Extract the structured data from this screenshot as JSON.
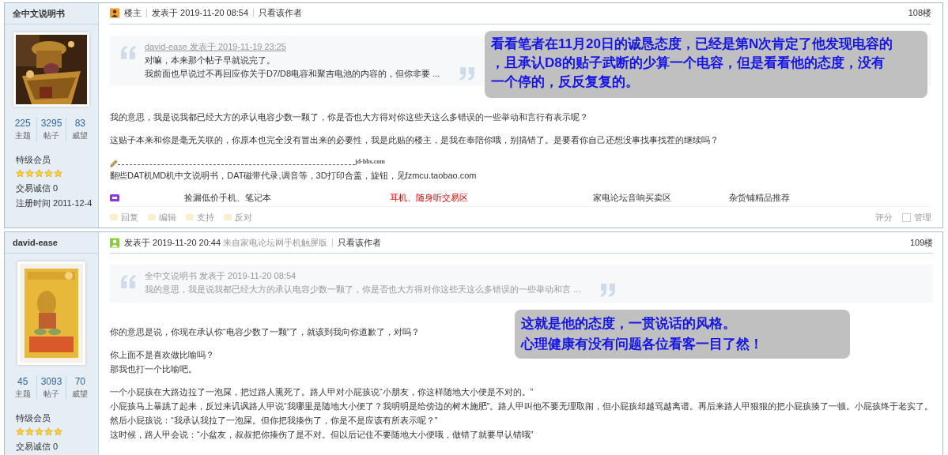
{
  "posts": [
    {
      "author": {
        "name": "全中文说明书",
        "stats": [
          {
            "value": "225",
            "label": "主题"
          },
          {
            "value": "3295",
            "label": "帖子"
          },
          {
            "value": "83",
            "label": "威望"
          }
        ],
        "rank": "特级会员",
        "stars": 5,
        "credit_label": "交易诚信",
        "credit": "0",
        "reg_label": "注册时间",
        "reg": "2011-12-4"
      },
      "header": {
        "kind": "op",
        "badge": "楼主",
        "posted": "发表于 2019-11-20 08:54",
        "author_only": "只看该作者",
        "floor": "108楼"
      },
      "quote": {
        "byline": "david-ease 发表于 2019-11-19 23:25",
        "link": true,
        "lines": [
          "对嘛，本来那个帖子早就说完了。",
          "我前面也早说过不再回应你关于D7/D8电容和聚吉电池的内容的，但你非要 ..."
        ]
      },
      "paragraphs": [
        [
          "我的意思，我是说我都已经大方的承认电容少数一颗了，你是否也大方得对你这些天这么多错误的一些举动和言行有表示呢？"
        ],
        [
          "这贴子本来和你是毫无关联的，你原本也完全没有冒出来的必要性，我是此贴的楼主，是我在奉陪你哦，别搞错了。是要看你自己还想没事找事找茬的继续吗？"
        ]
      ],
      "signature": {
        "site": "jd-bbs.com",
        "text": "翻些DAT机MD机中文说明书，DAT磁带代录,调音等，3D打印合盖，旋钮，见fzmcu.taobao.com"
      },
      "ads": [
        {
          "text": "捡漏低价手机、笔记本",
          "highlighted": false
        },
        {
          "text": "耳机、随身听交易区",
          "highlighted": true
        },
        {
          "text": "家电论坛音响买卖区",
          "highlighted": false
        },
        {
          "text": "杂货铺精品推荐",
          "highlighted": false
        }
      ],
      "actions": [
        "回复",
        "编辑",
        "支持",
        "反对"
      ],
      "manage": {
        "rate": "评分",
        "checked": false,
        "label": "管理"
      },
      "note": [
        "看看笔者在11月20日的诚恳态度，已经是第N次肯定了他发现电容的",
        "，且承认D8的贴子武断的少算一个电容，但是看看他的态度，没有",
        "一个停的，反反复复的。"
      ]
    },
    {
      "author": {
        "name": "david-ease",
        "stats": [
          {
            "value": "45",
            "label": "主题"
          },
          {
            "value": "3093",
            "label": "帖子"
          },
          {
            "value": "70",
            "label": "威望"
          }
        ],
        "rank": "特级会员",
        "stars": 5,
        "credit_label": "交易诚信",
        "credit": "0"
      },
      "header": {
        "kind": "mobile",
        "posted": "发表于 2019-11-20 20:44",
        "via": "来自家电论坛网手机触屏版",
        "author_only": "只看该作者",
        "floor": "109楼"
      },
      "quote": {
        "byline": "全中文说明书 发表于 2019-11-20 08:54",
        "link": false,
        "lines": [
          "我的意思，我是说我都已经大方的承认电容少数一颗了，你是否也大方得对你这些天这么多错误的一些举动和言 ..."
        ]
      },
      "paragraphs": [
        [
          "你的意思是说，你现在承认你“电容少数了一颗”了，就该到我向你道歉了，对吗？"
        ],
        [
          "你上面不是喜欢做比喻吗？",
          "那我也打一个比喻吧。"
        ],
        [
          "一个小屁孩在大路边拉了一泡屎，把过路人熏死了。路人甲对小屁孩说“小朋友，你这样随地大小便是不对的。”",
          "小屁孩马上暴跳了起来，反过来讥讽路人甲说“我哪里是随地大小便了？我明明是给傍边的树木施肥”。路人甲叫他不要无理取闹，但小屁孩却越骂越离谱。再后来路人甲狠狠的把小屁孩揍了一顿。小屁孩终于老实了。",
          "然后小屁孩说：“我承认我拉了一泡屎。但你把我揍伤了，你是不是应该有所表示呢？”",
          "这时候，路人甲会说：“小盆友，叔叔把你揍伤了是不对。但以后记住不要随地大小便哦，做错了就要早认错哦”"
        ]
      ],
      "note": [
        "这就是他的态度，一贯说话的风格。",
        "心理健康有没有问题各位看客一目了然！"
      ]
    }
  ]
}
